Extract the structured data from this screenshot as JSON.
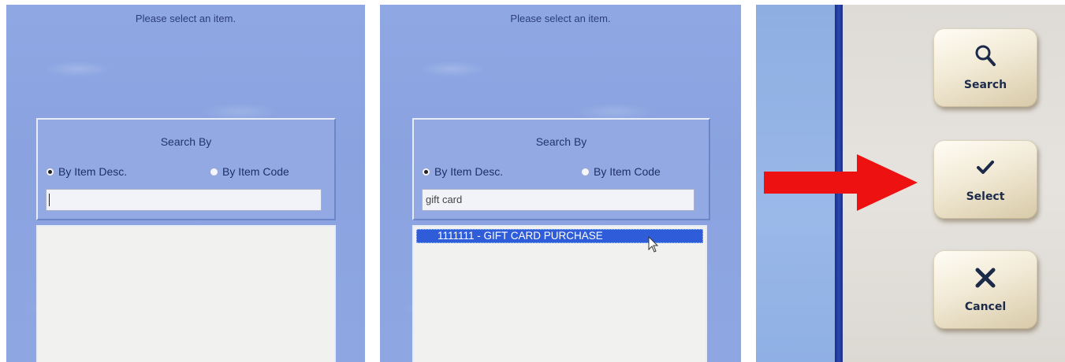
{
  "panel_1": {
    "prompt": "Please select an item.",
    "search_by_label": "Search By",
    "radio_desc_label": "By Item Desc.",
    "radio_code_label": "By Item Code",
    "search_value": ""
  },
  "panel_2": {
    "prompt": "Please select an item.",
    "search_by_label": "Search By",
    "radio_desc_label": "By Item Desc.",
    "radio_code_label": "By Item Code",
    "search_value": "gift card",
    "results": [
      "1111111  -  GIFT CARD PURCHASE"
    ]
  },
  "panel_3": {
    "buttons": {
      "search": "Search",
      "select": "Select",
      "cancel": "Cancel"
    }
  },
  "colors": {
    "background_blue": "#8fa8e4",
    "selection_blue": "#2f5cd8",
    "arrow_red": "#ee1111",
    "button_cream": "#f2ead6"
  }
}
